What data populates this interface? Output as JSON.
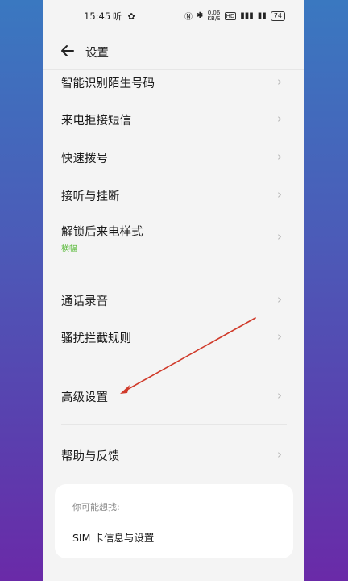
{
  "status_bar": {
    "time": "15:45",
    "left_icons": "听 ✿",
    "speed_value": "0.06",
    "speed_unit": "KB/S",
    "battery": "74",
    "hd_badge": "HD",
    "signal": "4G"
  },
  "header": {
    "title": "设置"
  },
  "items": [
    {
      "label": "智能识别陌生号码"
    },
    {
      "label": "来电拒接短信"
    },
    {
      "label": "快速拨号"
    },
    {
      "label": "接听与挂断"
    },
    {
      "label": "解锁后来电样式",
      "sub": "横幅"
    },
    {
      "label": "通话录音"
    },
    {
      "label": "骚扰拦截规则"
    },
    {
      "label": "高级设置"
    },
    {
      "label": "帮助与反馈"
    }
  ],
  "suggest": {
    "title": "你可能想找:",
    "item": "SIM 卡信息与设置"
  },
  "colors": {
    "accent_sub": "#5cbb3d",
    "annotation_arrow": "#d03a2a"
  }
}
